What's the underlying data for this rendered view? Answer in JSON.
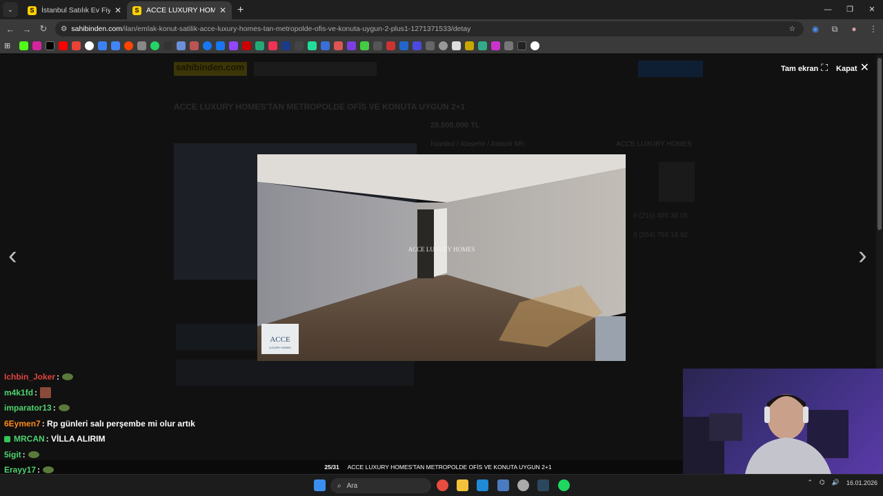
{
  "browser": {
    "tabs": [
      {
        "favicon": "S",
        "title": "İstanbul Satılık Ev Fiyatları sahib"
      },
      {
        "favicon": "S",
        "title": "ACCE LUXURY HOMES'TAN ME"
      }
    ],
    "url_host": "sahibinden.com",
    "url_path": "/ilan/emlak-konut-satilik-acce-luxury-homes-tan-metropolde-ofis-ve-konuta-uygun-2-plus1-1271371533/detay"
  },
  "gallery": {
    "fullscreen_label": "Tam ekran",
    "close_label": "Kapat",
    "watermark": "ACCE LUXURY HOMES",
    "logo_text": "ACCE",
    "logo_sub": "LUXURY HOMES",
    "counter": "25/31",
    "caption": "ACCE LUXURY HOMES'TAN METROPOLDE OFİS VE KONUTA UYGUN 2+1"
  },
  "background_page": {
    "site_logo": "sahibinden.com",
    "listing_title": "ACCE LUXURY HOMES'TAN METROPOLDE OFİS VE KONUTA UYGUN 2+1",
    "price": "28.500.000 TL",
    "location": "İstanbul / Ataşehir / Atatürk Mh.",
    "agency": "ACCE LUXURY HOMES",
    "phone1": "0 (216) 465 38 05",
    "phone2": "0 (554) 769 18 92"
  },
  "chat": [
    {
      "user": "Ichbin_Joker",
      "color": "#e0443e",
      "text": "",
      "emote": "round"
    },
    {
      "user": "m4k1fd",
      "color": "#4fd36f",
      "text": "",
      "emote": "box"
    },
    {
      "user": "imparator13",
      "color": "#4fd36f",
      "text": "",
      "emote": "round"
    },
    {
      "user": "6Eymen7",
      "color": "#ff8a1c",
      "text": "Rp günleri salı perşembe mi olur artık",
      "emote": ""
    },
    {
      "user": "MRCAN",
      "color": "#4fd36f",
      "text": "VİLLA ALIRIM",
      "emote": "",
      "badge": true
    },
    {
      "user": "5igit",
      "color": "#4fd36f",
      "text": "",
      "emote": "round"
    },
    {
      "user": "Erayy17",
      "color": "#4fd36f",
      "text": "",
      "emote": "round"
    }
  ],
  "taskbar": {
    "search_placeholder": "Ara",
    "date": "16.01.2026"
  }
}
